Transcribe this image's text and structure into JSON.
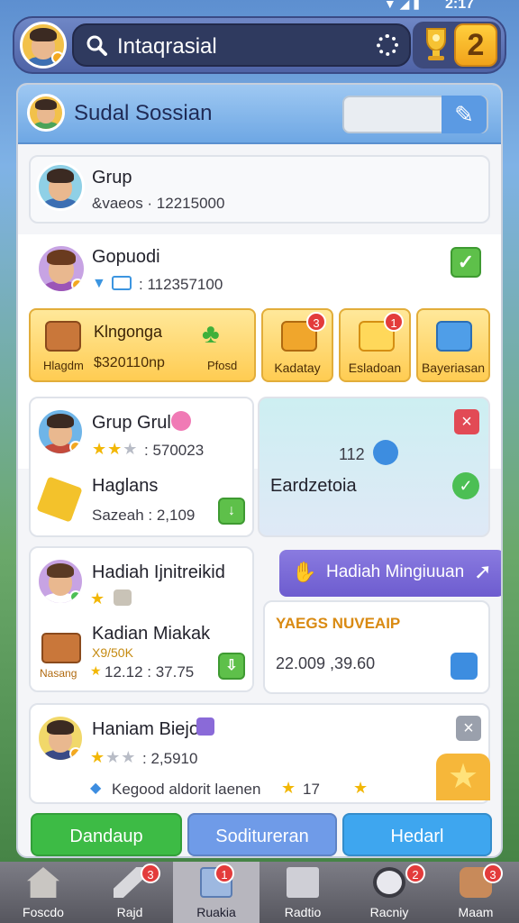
{
  "status": {
    "time": "2:17",
    "icons": "▼ ◢ ▮"
  },
  "topbar": {
    "search_text": "Intaqrasial",
    "level": "2"
  },
  "header": {
    "title": "Sudal Sossian"
  },
  "cards": {
    "grup": {
      "name": "Grup",
      "sub": "&vaeos · 12215000"
    },
    "gopuodi": {
      "name": "Gopuodi",
      "sub": ": 112357100"
    },
    "grup_grul": {
      "name": "Grup Grul",
      "stars_value": ": 570023",
      "item": "Haglans",
      "item_sub": "Sazeah : 2,109"
    },
    "eardzetoia": {
      "value": "112",
      "label": "Eardzetoia"
    },
    "hadiah_ijn": {
      "name": "Hadiah Ijnitreikid",
      "item": "Kadian Miakak",
      "item_price": "X9/50K",
      "item_label": "Nasang",
      "item_sub": "12.12 : 37.75"
    },
    "purple_banner": "Hadiah Mingiuuan",
    "yaegs": {
      "title": "YAEGS NUVEAIP",
      "value": "22.009 ,39.60"
    },
    "haniam": {
      "name": "Haniam Biejo",
      "stars_value": ": 2,5910",
      "footer": "Kegood aldorit laenen",
      "footer_value": "17"
    }
  },
  "rewards": [
    {
      "label": "Hlagdm",
      "title": "Klngonga",
      "value": "$320110np"
    },
    {
      "label": "Pfosd"
    },
    {
      "label": "Kadatay",
      "badge": "3"
    },
    {
      "label": "Esladoan",
      "badge": "1"
    },
    {
      "label": "Bayeriasan"
    }
  ],
  "actions": [
    {
      "label": "Dandaup",
      "color": "#3dbb45"
    },
    {
      "label": "Soditureran",
      "color": "#6f9be8"
    },
    {
      "label": "Hedarl",
      "color": "#3ea6ef"
    }
  ],
  "nav": [
    {
      "label": "Foscdo"
    },
    {
      "label": "Rajd",
      "badge": "3"
    },
    {
      "label": "Ruakia",
      "badge": "1"
    },
    {
      "label": "Radtio"
    },
    {
      "label": "Racniy",
      "badge": "2"
    },
    {
      "label": "Maam",
      "badge": "3"
    }
  ]
}
